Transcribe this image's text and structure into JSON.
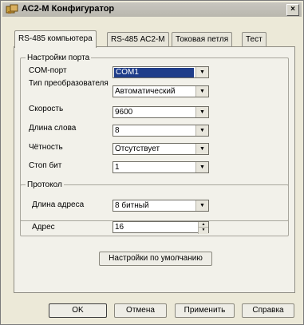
{
  "window": {
    "title": "АС2-М Конфигуратор",
    "close_glyph": "×"
  },
  "tabs": [
    {
      "label": "RS-485 компьютера",
      "active": true
    },
    {
      "label": "RS-485 АС2-М",
      "active": false
    },
    {
      "label": "Токовая петля",
      "active": false
    },
    {
      "label": "Тест",
      "active": false
    }
  ],
  "port_settings": {
    "legend": "Настройки порта",
    "fields": [
      {
        "label": "COM-порт",
        "value": "COM1"
      },
      {
        "label": "Тип преобразователя",
        "value": "Автоматический"
      },
      {
        "label": "Скорость",
        "value": "9600"
      },
      {
        "label": "Длина слова",
        "value": "8"
      },
      {
        "label": "Чётность",
        "value": "Отсутствует"
      },
      {
        "label": "Стоп бит",
        "value": "1"
      }
    ]
  },
  "protocol": {
    "legend": "Протокол",
    "address_length_label": "Длина адреса",
    "address_length_value": "8 битный",
    "address_label": "Адрес",
    "address_value": "16"
  },
  "defaults_button": "Настройки по умолчанию",
  "footer": {
    "ok": "OK",
    "cancel": "Отмена",
    "apply": "Применить",
    "help": "Справка"
  },
  "icons": {
    "combo_arrow": "▼",
    "spin_up": "▲",
    "spin_down": "▼"
  }
}
